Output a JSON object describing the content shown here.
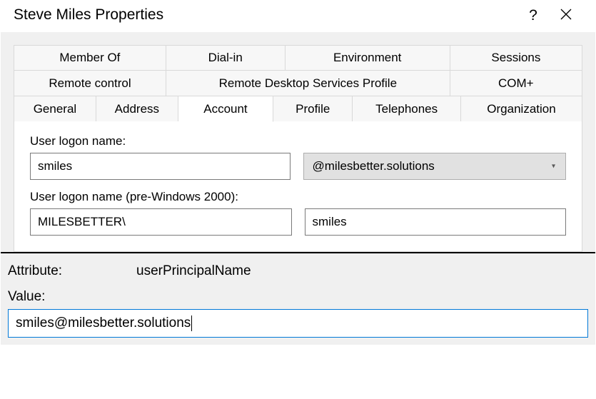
{
  "window": {
    "title": "Steve Miles Properties",
    "help_label": "?",
    "close_label": "Close"
  },
  "tabs": {
    "row1": [
      {
        "label": "Member Of"
      },
      {
        "label": "Dial-in"
      },
      {
        "label": "Environment"
      },
      {
        "label": "Sessions"
      }
    ],
    "row2": [
      {
        "label": "Remote control"
      },
      {
        "label": "Remote Desktop Services Profile"
      },
      {
        "label": "COM+"
      }
    ],
    "row3": [
      {
        "label": "General"
      },
      {
        "label": "Address"
      },
      {
        "label": "Account",
        "active": true
      },
      {
        "label": "Profile"
      },
      {
        "label": "Telephones"
      },
      {
        "label": "Organization"
      }
    ]
  },
  "account": {
    "logon_label": "User logon name:",
    "logon_value": "smiles",
    "upn_suffix": "@milesbetter.solutions",
    "pre2000_label": "User logon name (pre-Windows 2000):",
    "pre2000_domain": "MILESBETTER\\",
    "pre2000_user": "smiles"
  },
  "attribute_editor": {
    "attribute_label": "Attribute:",
    "attribute_name": "userPrincipalName",
    "value_label": "Value:",
    "value": "smiles@milesbetter.solutions"
  }
}
